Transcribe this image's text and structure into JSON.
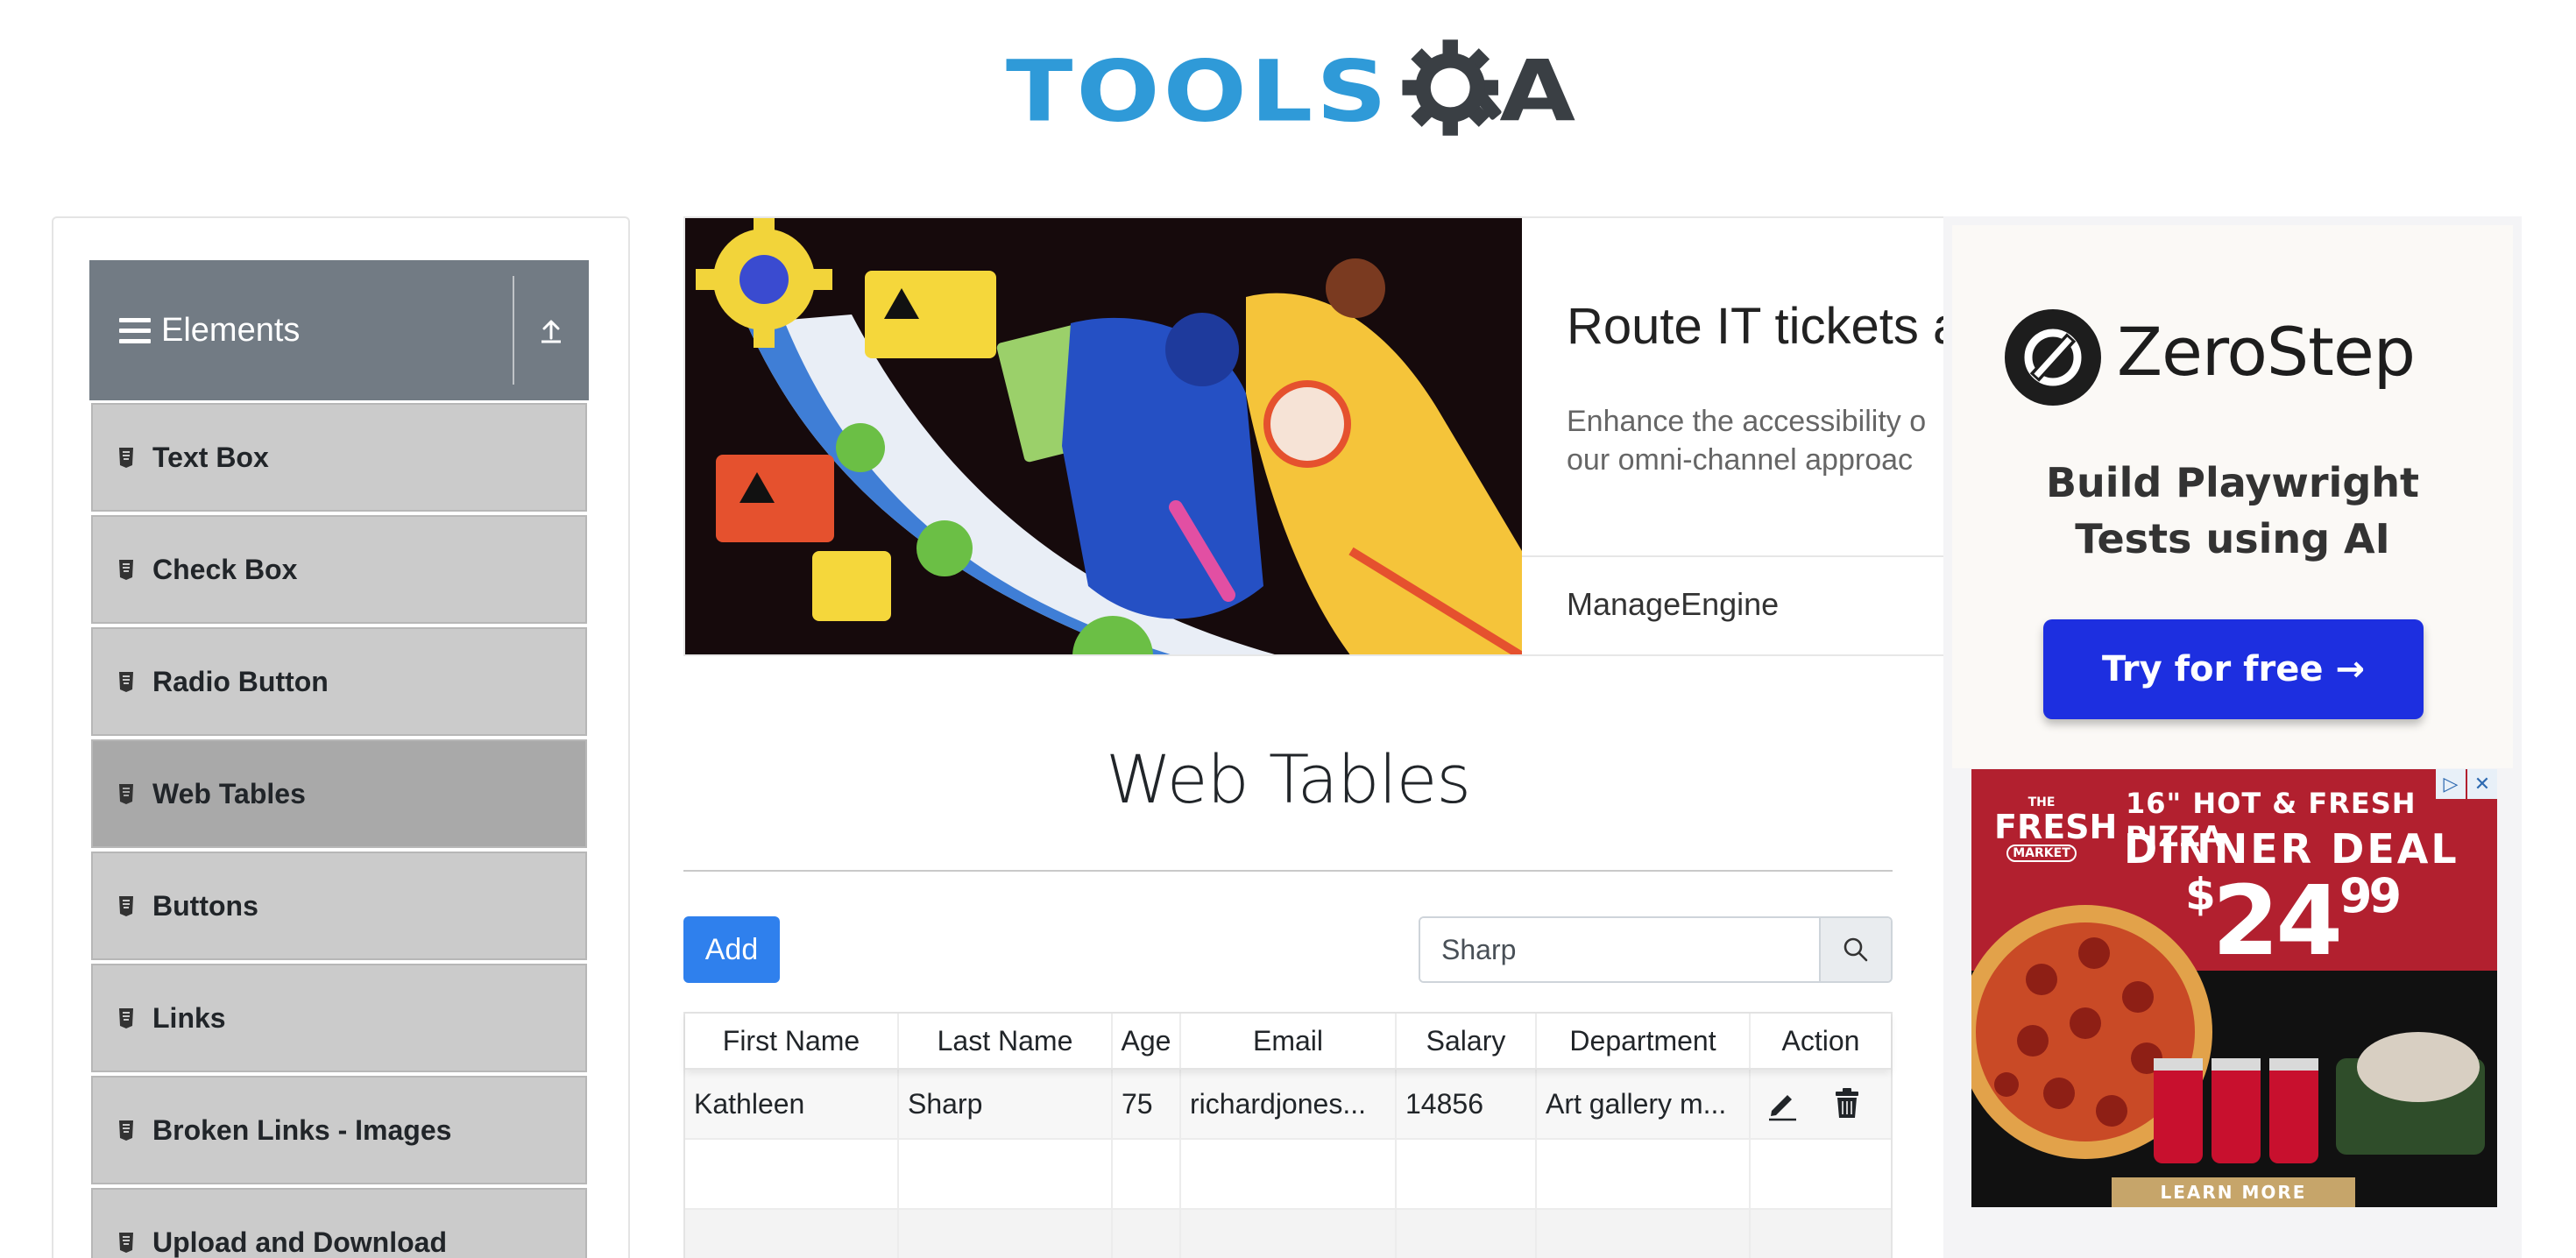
{
  "header": {
    "logo_text_main": "TOOLS",
    "logo_text_end": "A"
  },
  "sidebar": {
    "group_title": "Elements",
    "items": [
      {
        "label": "Text Box"
      },
      {
        "label": "Check Box"
      },
      {
        "label": "Radio Button"
      },
      {
        "label": "Web Tables",
        "active": true
      },
      {
        "label": "Buttons"
      },
      {
        "label": "Links"
      },
      {
        "label": "Broken Links - Images"
      },
      {
        "label": "Upload and Download"
      }
    ]
  },
  "banner_ad": {
    "headline": "Route IT tickets a",
    "body_line1": "Enhance the accessibility o",
    "body_line2": "our omni-channel approac",
    "brand": "ManageEngine"
  },
  "main": {
    "title": "Web Tables",
    "add_label": "Add",
    "search": {
      "value": "Sharp"
    },
    "table": {
      "columns": [
        "First Name",
        "Last Name",
        "Age",
        "Email",
        "Salary",
        "Department",
        "Action"
      ],
      "rows": [
        {
          "first_name": "Kathleen",
          "last_name": "Sharp",
          "age": "75",
          "email": "richardjones...",
          "salary": "14856",
          "department": "Art gallery m..."
        }
      ]
    }
  },
  "side_ad": {
    "brand": "ZeroStep",
    "tagline_line1": "Build Playwright",
    "tagline_line2": "Tests using AI",
    "cta": "Try for free →"
  },
  "pizza_ad": {
    "badge_the": "THE",
    "badge_fresh": "FRESH",
    "badge_market": "MARKET",
    "line1": "16\" HOT & FRESH PIZZA",
    "line2": "DINNER DEAL",
    "price_dollar": "$",
    "price_main": "24",
    "price_cents": "99",
    "cta": "LEARN MORE",
    "adchoice_info": "▷",
    "adchoice_close": "✕"
  },
  "colors": {
    "brand_blue": "#2f9ad8",
    "sidebar_header": "#727b84",
    "menu_item": "#cbcbcb",
    "menu_item_active": "#a9a9a9",
    "primary_button": "#2f80ed",
    "cta_blue": "#1d2fe0",
    "pizza_red": "#b2202f"
  },
  "icons": {
    "group_menu": "hamburger-icon",
    "group_collapse": "collapse-up-icon",
    "menu_item": "document-icon",
    "search": "search-icon",
    "edit": "pencil-icon",
    "delete": "trash-icon"
  }
}
